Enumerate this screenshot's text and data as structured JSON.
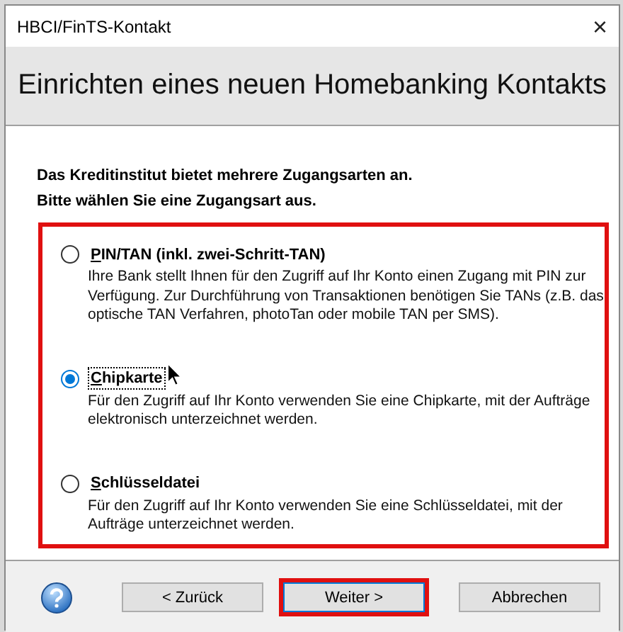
{
  "window": {
    "title": "HBCI/FinTS-Kontakt",
    "close": "×"
  },
  "header": {
    "title": "Einrichten eines neuen Homebanking Kontakts"
  },
  "intro": [
    "Das Kreditinstitut bietet mehrere Zugangsarten an.",
    "Bitte wählen Sie eine Zugangsart aus."
  ],
  "options": [
    {
      "label": "PIN/TAN (inkl. zwei-Schritt-TAN)",
      "description": "Ihre Bank stellt Ihnen für den Zugriff auf Ihr Konto einen Zugang mit PIN zur Verfügung. Zur Durchführung von Transaktionen benötigen Sie TANs (z.B. das optische TAN Verfahren, photoTan oder mobile TAN per SMS).",
      "selected": false
    },
    {
      "label": "Chipkarte",
      "description": "Für den Zugriff auf Ihr Konto verwenden Sie eine Chipkarte, mit der Aufträge elektronisch unterzeichnet werden.",
      "selected": true
    },
    {
      "label": "Schlüsseldatei",
      "description": "Für den Zugriff auf Ihr Konto verwenden Sie eine Schlüsseldatei, mit der Aufträge unterzeichnet werden.",
      "selected": false
    }
  ],
  "buttons": [
    {
      "label": "< Zurück",
      "highlighted": false
    },
    {
      "label": "Weiter >",
      "highlighted": true
    },
    {
      "label": "Abbrechen",
      "highlighted": false
    }
  ]
}
